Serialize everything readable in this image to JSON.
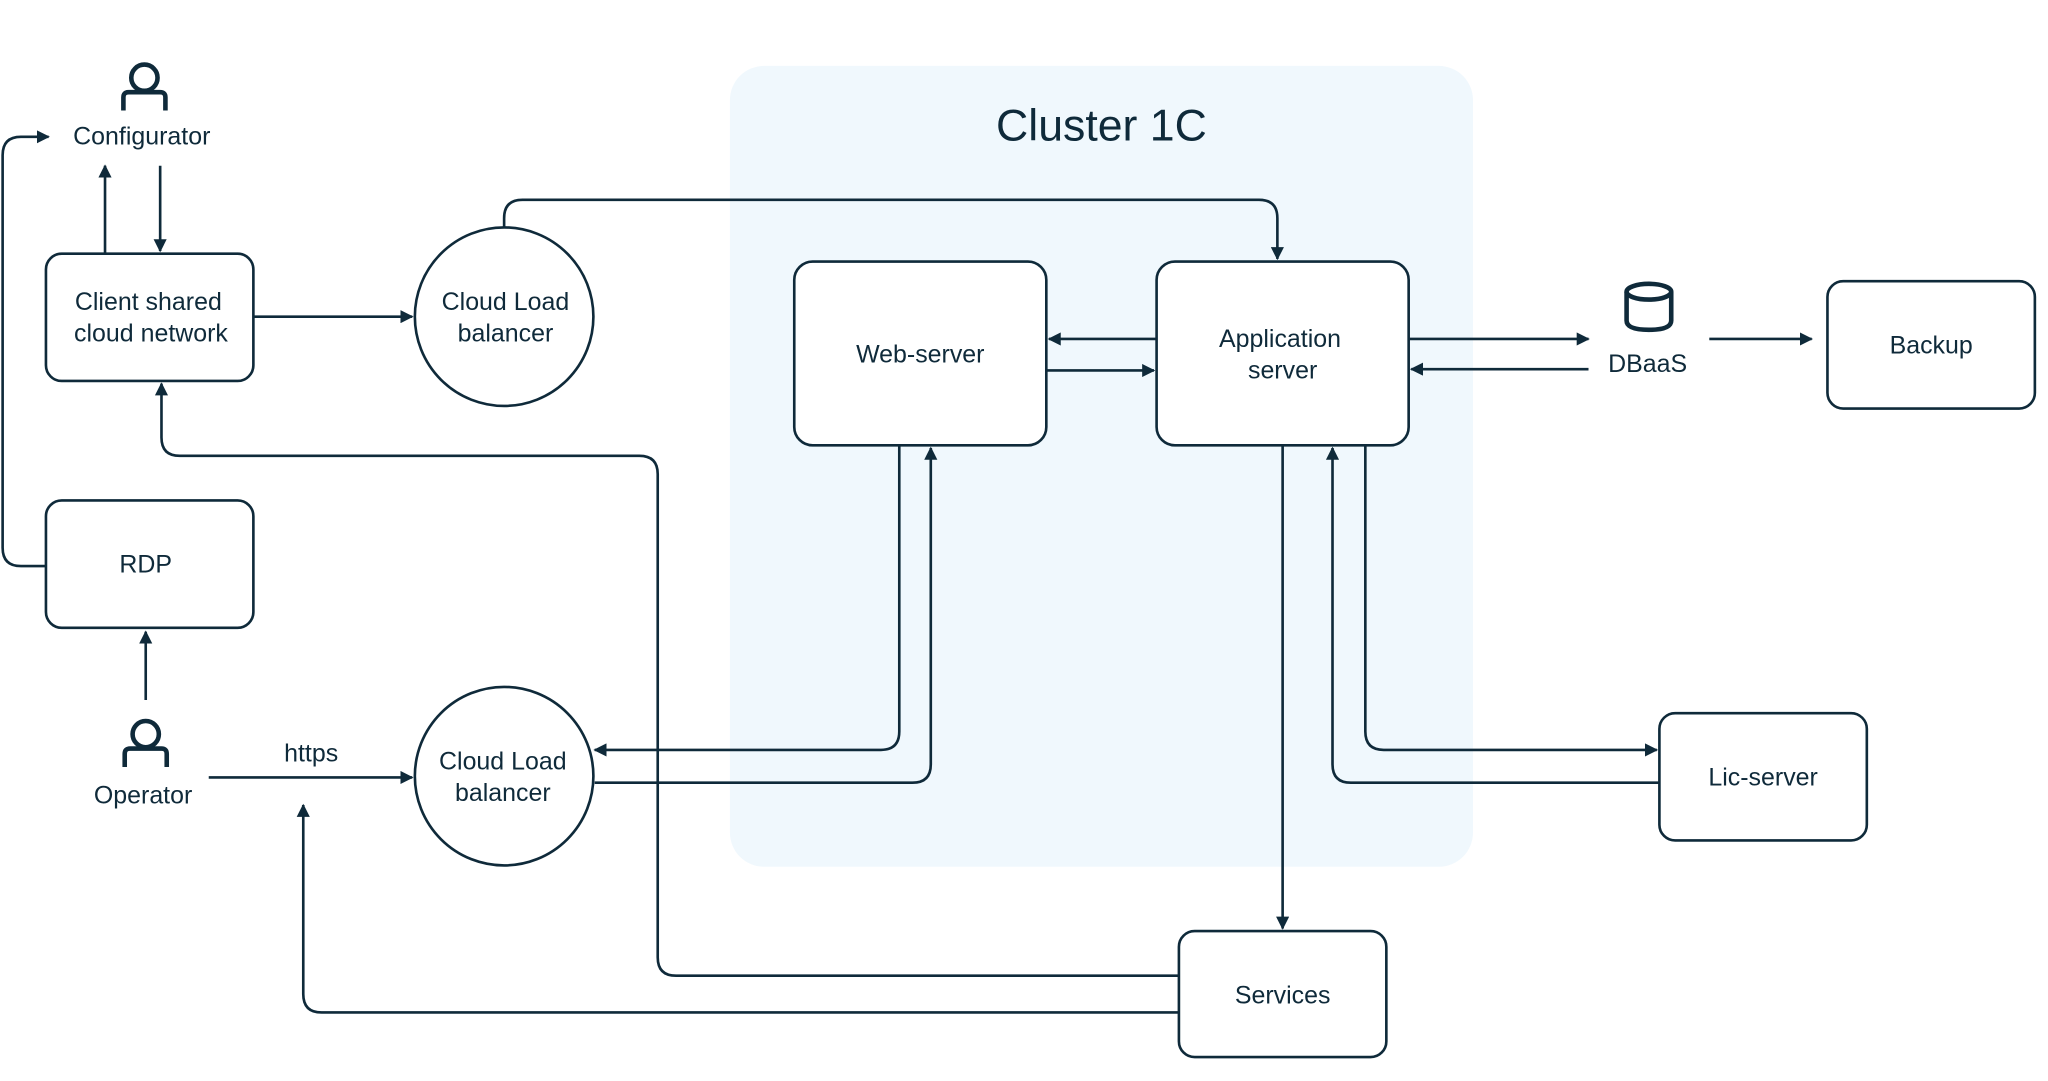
{
  "colors": {
    "line": "#0f2a3a",
    "cluster_bg": "#f0f8fd",
    "background": "#ffffff"
  },
  "cluster": {
    "title": "Cluster 1C"
  },
  "actors": {
    "configurator": {
      "label": "Configurator",
      "icon": "user-icon"
    },
    "operator": {
      "label": "Operator",
      "icon": "user-icon"
    }
  },
  "nodes": {
    "client_network": {
      "line1": "Client shared",
      "line2": "cloud network"
    },
    "lb_top": {
      "line1": "Cloud Load",
      "line2": "balancer"
    },
    "lb_bottom": {
      "line1": "Cloud Load",
      "line2": "balancer"
    },
    "web_server": {
      "label": "Web-server"
    },
    "app_server": {
      "line1": "Application",
      "line2": "server"
    },
    "dbaas": {
      "label": "DBaaS",
      "icon": "database-icon"
    },
    "backup": {
      "label": "Backup"
    },
    "rdp": {
      "label": "RDP"
    },
    "lic_server": {
      "label": "Lic-server"
    },
    "services": {
      "label": "Services"
    }
  },
  "edges": {
    "https_label": "https"
  }
}
